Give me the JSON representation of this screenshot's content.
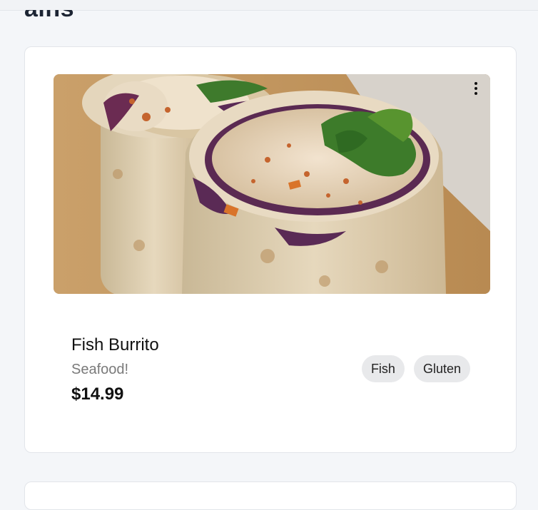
{
  "page": {
    "section_heading": "ains"
  },
  "menu_item": {
    "name": "Fish Burrito",
    "category": "Seafood!",
    "price": "$14.99",
    "tags": [
      "Fish",
      "Gluten"
    ],
    "image_subject": "fish-burrito-photo",
    "menu_icon": "more-vertical-icon"
  }
}
